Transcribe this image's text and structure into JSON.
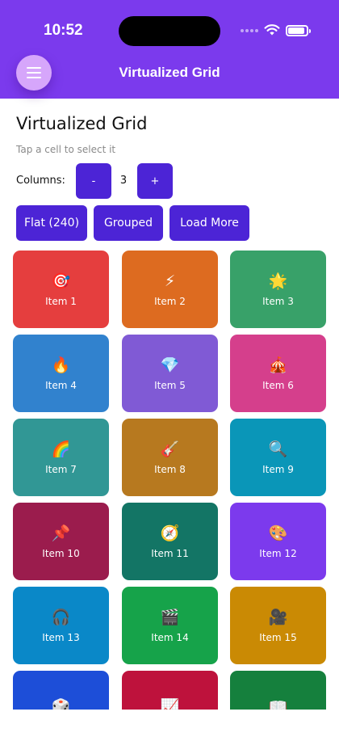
{
  "status_bar": {
    "time": "10:52"
  },
  "nav": {
    "title": "Virtualized Grid",
    "menu_icon": "hamburger-menu-icon"
  },
  "page": {
    "title": "Virtualized Grid",
    "subtitle": "Tap a cell to select it"
  },
  "columns": {
    "label": "Columns:",
    "minus_label": "-",
    "value": "3",
    "plus_label": "+"
  },
  "modes": {
    "flat_label": "Flat (240)",
    "grouped_label": "Grouped",
    "load_more_label": "Load More"
  },
  "colors": {
    "header": "#7b3aed",
    "accent_button": "#4c24d6"
  },
  "grid": {
    "items": [
      {
        "label": "Item 1",
        "icon": "🎯",
        "color": "#e53e3e"
      },
      {
        "label": "Item 2",
        "icon": "⚡",
        "color": "#dd6b20"
      },
      {
        "label": "Item 3",
        "icon": "🌟",
        "color": "#38a169"
      },
      {
        "label": "Item 4",
        "icon": "🔥",
        "color": "#3182ce"
      },
      {
        "label": "Item 5",
        "icon": "💎",
        "color": "#805ad5"
      },
      {
        "label": "Item 6",
        "icon": "🎪",
        "color": "#d53f8c"
      },
      {
        "label": "Item 7",
        "icon": "🌈",
        "color": "#319795"
      },
      {
        "label": "Item 8",
        "icon": "🎸",
        "color": "#b7791f"
      },
      {
        "label": "Item 9",
        "icon": "🔍",
        "color": "#0a96b8"
      },
      {
        "label": "Item 10",
        "icon": "📌",
        "color": "#9b1c4d"
      },
      {
        "label": "Item 11",
        "icon": "🧭",
        "color": "#137565"
      },
      {
        "label": "Item 12",
        "icon": "🎨",
        "color": "#7c3aed"
      },
      {
        "label": "Item 13",
        "icon": "🎧",
        "color": "#0a88c8"
      },
      {
        "label": "Item 14",
        "icon": "🎬",
        "color": "#16a34a"
      },
      {
        "label": "Item 15",
        "icon": "🎥",
        "color": "#ca8a04"
      },
      {
        "label": "",
        "icon": "🎲",
        "color": "#1d4ed8"
      },
      {
        "label": "",
        "icon": "📈",
        "color": "#be123c"
      },
      {
        "label": "",
        "icon": "📖",
        "color": "#15803d"
      }
    ]
  }
}
